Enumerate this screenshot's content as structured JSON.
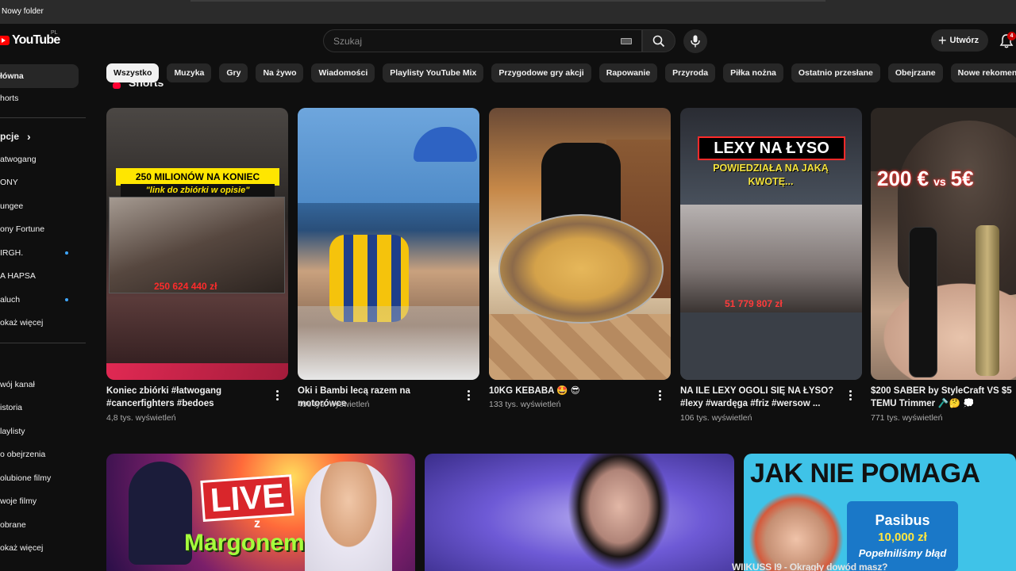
{
  "os": {
    "title": "Nowy folder"
  },
  "header": {
    "logo_text": "YouTube",
    "logo_region": "PL",
    "search_placeholder": "Szukaj",
    "create_label": "Utwórz",
    "notification_count": "4"
  },
  "sidebar": {
    "items": [
      {
        "label": "łówna"
      },
      {
        "label": "horts"
      },
      {
        "label": "pcje"
      },
      {
        "label": "atwogang"
      },
      {
        "label": "ONY"
      },
      {
        "label": "ungee"
      },
      {
        "label": "ony Fortune"
      },
      {
        "label": "IRGH."
      },
      {
        "label": "A HAPSA"
      },
      {
        "label": "aluch"
      },
      {
        "label": "okaż więcej"
      },
      {
        "label": "wój kanał"
      },
      {
        "label": "istoria"
      },
      {
        "label": "laylisty"
      },
      {
        "label": "o obejrzenia"
      },
      {
        "label": "olubione filmy"
      },
      {
        "label": "woje filmy"
      },
      {
        "label": "obrane"
      },
      {
        "label": "okaż więcej"
      }
    ],
    "section_chevron": "›"
  },
  "chips": [
    "Wszystko",
    "Muzyka",
    "Gry",
    "Na żywo",
    "Wiadomości",
    "Playlisty YouTube Mix",
    "Przygodowe gry akcji",
    "Rapowanie",
    "Przyroda",
    "Piłka nożna",
    "Ostatnio przesłane",
    "Obejrzane",
    "Nowe rekomendacje"
  ],
  "shorts_label": "Shorts",
  "shorts": [
    {
      "title": "Koniec zbiórki #łatwogang #cancerfighters #bedoes",
      "views": "4,8 tys. wyświetleń",
      "overlay_line1": "250 MILIONÓW NA KONIEC",
      "overlay_line2": "\"link do zbiórki w opisie\"",
      "overlay_amount": "250 624 440 zł"
    },
    {
      "title": "Oki i Bambi lecą razem na motorówce",
      "views": "496 tys. wyświetleń"
    },
    {
      "title": "10KG KEBABA 🤩 😎",
      "views": "133 tys. wyświetleń"
    },
    {
      "title": "NA ILE LEXY OGOLI SIĘ NA ŁYSO? #lexy #wardęga #friz #wersow ...",
      "views": "106 tys. wyświetleń",
      "overlay_line1": "LEXY NA ŁYSO",
      "overlay_line2": "POWIEDZIAŁA NA JAKĄ KWOTĘ...",
      "overlay_amount": "51 779 807 zł"
    },
    {
      "title": "$200 SABER by StyleCraft VS $5 TEMU Trimmer 🪒🤔 💭",
      "views": "771 tys. wyświetleń",
      "overlay_price_a": "200 €",
      "overlay_vs": "vs",
      "overlay_price_b": "5€"
    }
  ],
  "videos": [
    {
      "overlay_live": "LIVE",
      "overlay_z": "z",
      "overlay_margonem": "Margonem"
    },
    {},
    {
      "overlay_headline": "JAK NIE POMAGA",
      "overlay_name": "Pasibus",
      "overlay_amount": "10,000 zł",
      "overlay_message": "Popełniliśmy błąd"
    }
  ],
  "cut_caption": "WIIKUSS I9 - Okrągły dowód masz?",
  "colors": {
    "accent": "#ff0000",
    "chip_active_bg": "#f1f1f1",
    "background": "#0f0f0f",
    "badge": "#cc0000"
  }
}
